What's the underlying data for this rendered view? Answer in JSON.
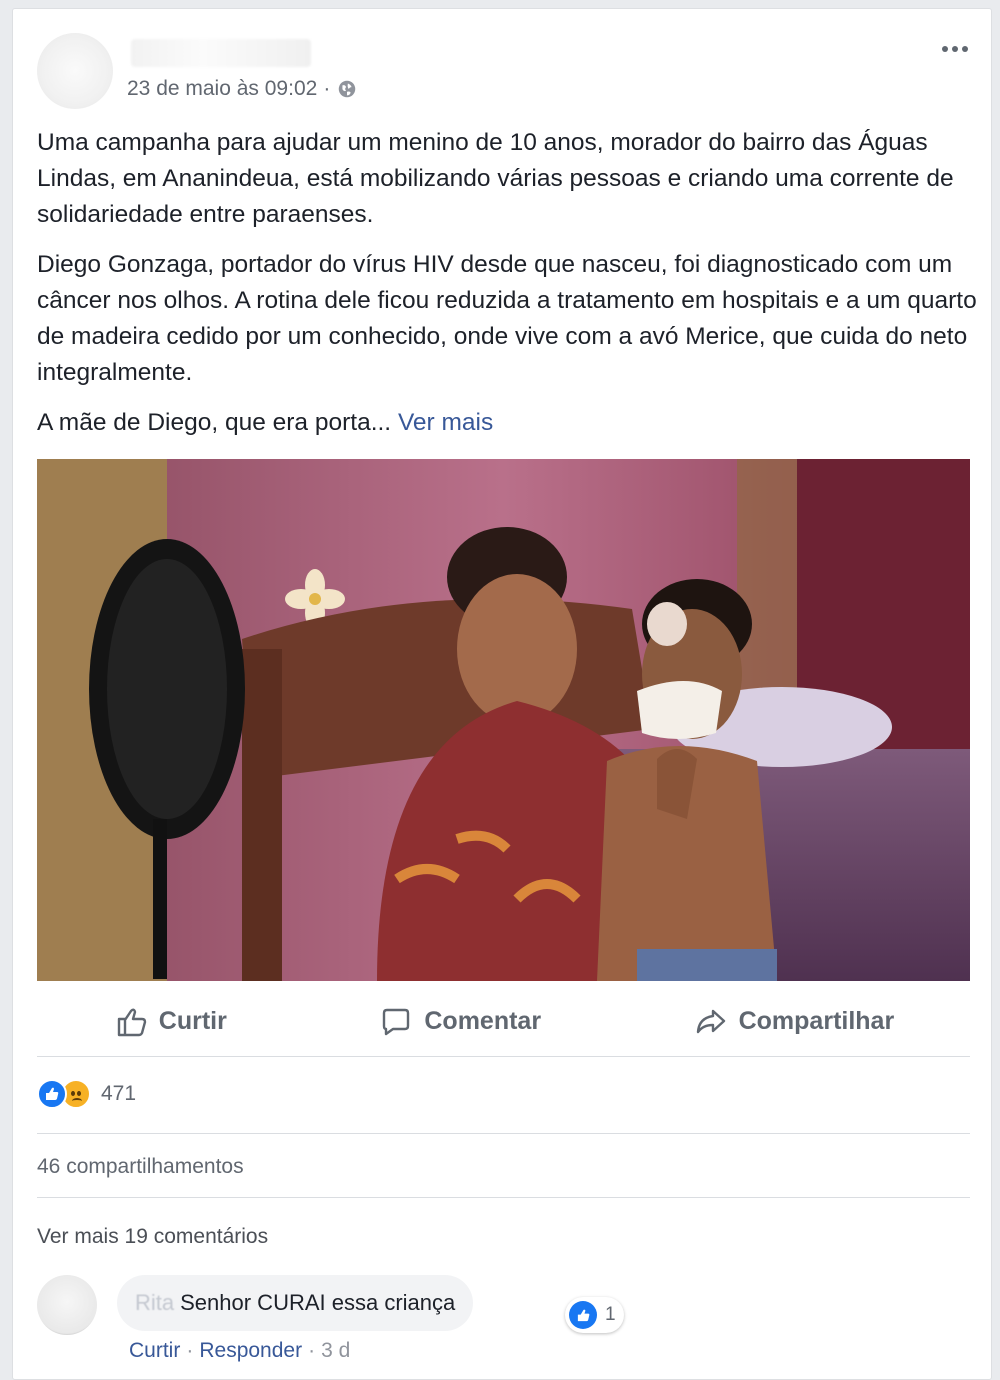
{
  "post": {
    "timestamp": "23 de maio às 09:02",
    "separator": "·",
    "paragraphs": [
      "Uma campanha para ajudar um menino de 10 anos, morador do bairro das Águas Lindas, em Ananindeua, está mobilizando várias pessoas e criando uma corrente de solidariedade entre paraenses.",
      "Diego Gonzaga, portador do vírus HIV desde que nasceu, foi diagnosticado com um câncer nos olhos. A rotina dele ficou reduzida a tratamento em hospitais e a um quarto de madeira cedido por um conhecido, onde vive com a avó Merice, que cuida do neto integralmente."
    ],
    "truncated_text": "A mãe de Diego, que era porta...",
    "see_more": "Ver mais"
  },
  "actions": {
    "like": "Curtir",
    "comment": "Comentar",
    "share": "Compartilhar"
  },
  "stats": {
    "reaction_count": "471",
    "shares": "46 compartilhamentos",
    "more_comments": "Ver mais 19 comentários"
  },
  "comment": {
    "author_partial": "Rita",
    "text": "Senhor CURAI essa criança",
    "like_count": "1",
    "like": "Curtir",
    "reply": "Responder",
    "age": "3 d",
    "separator": "·"
  },
  "colors": {
    "link": "#385898",
    "like_blue": "#1877f2",
    "sad_yellow": "#f7b125",
    "meta_gray": "#616770"
  }
}
